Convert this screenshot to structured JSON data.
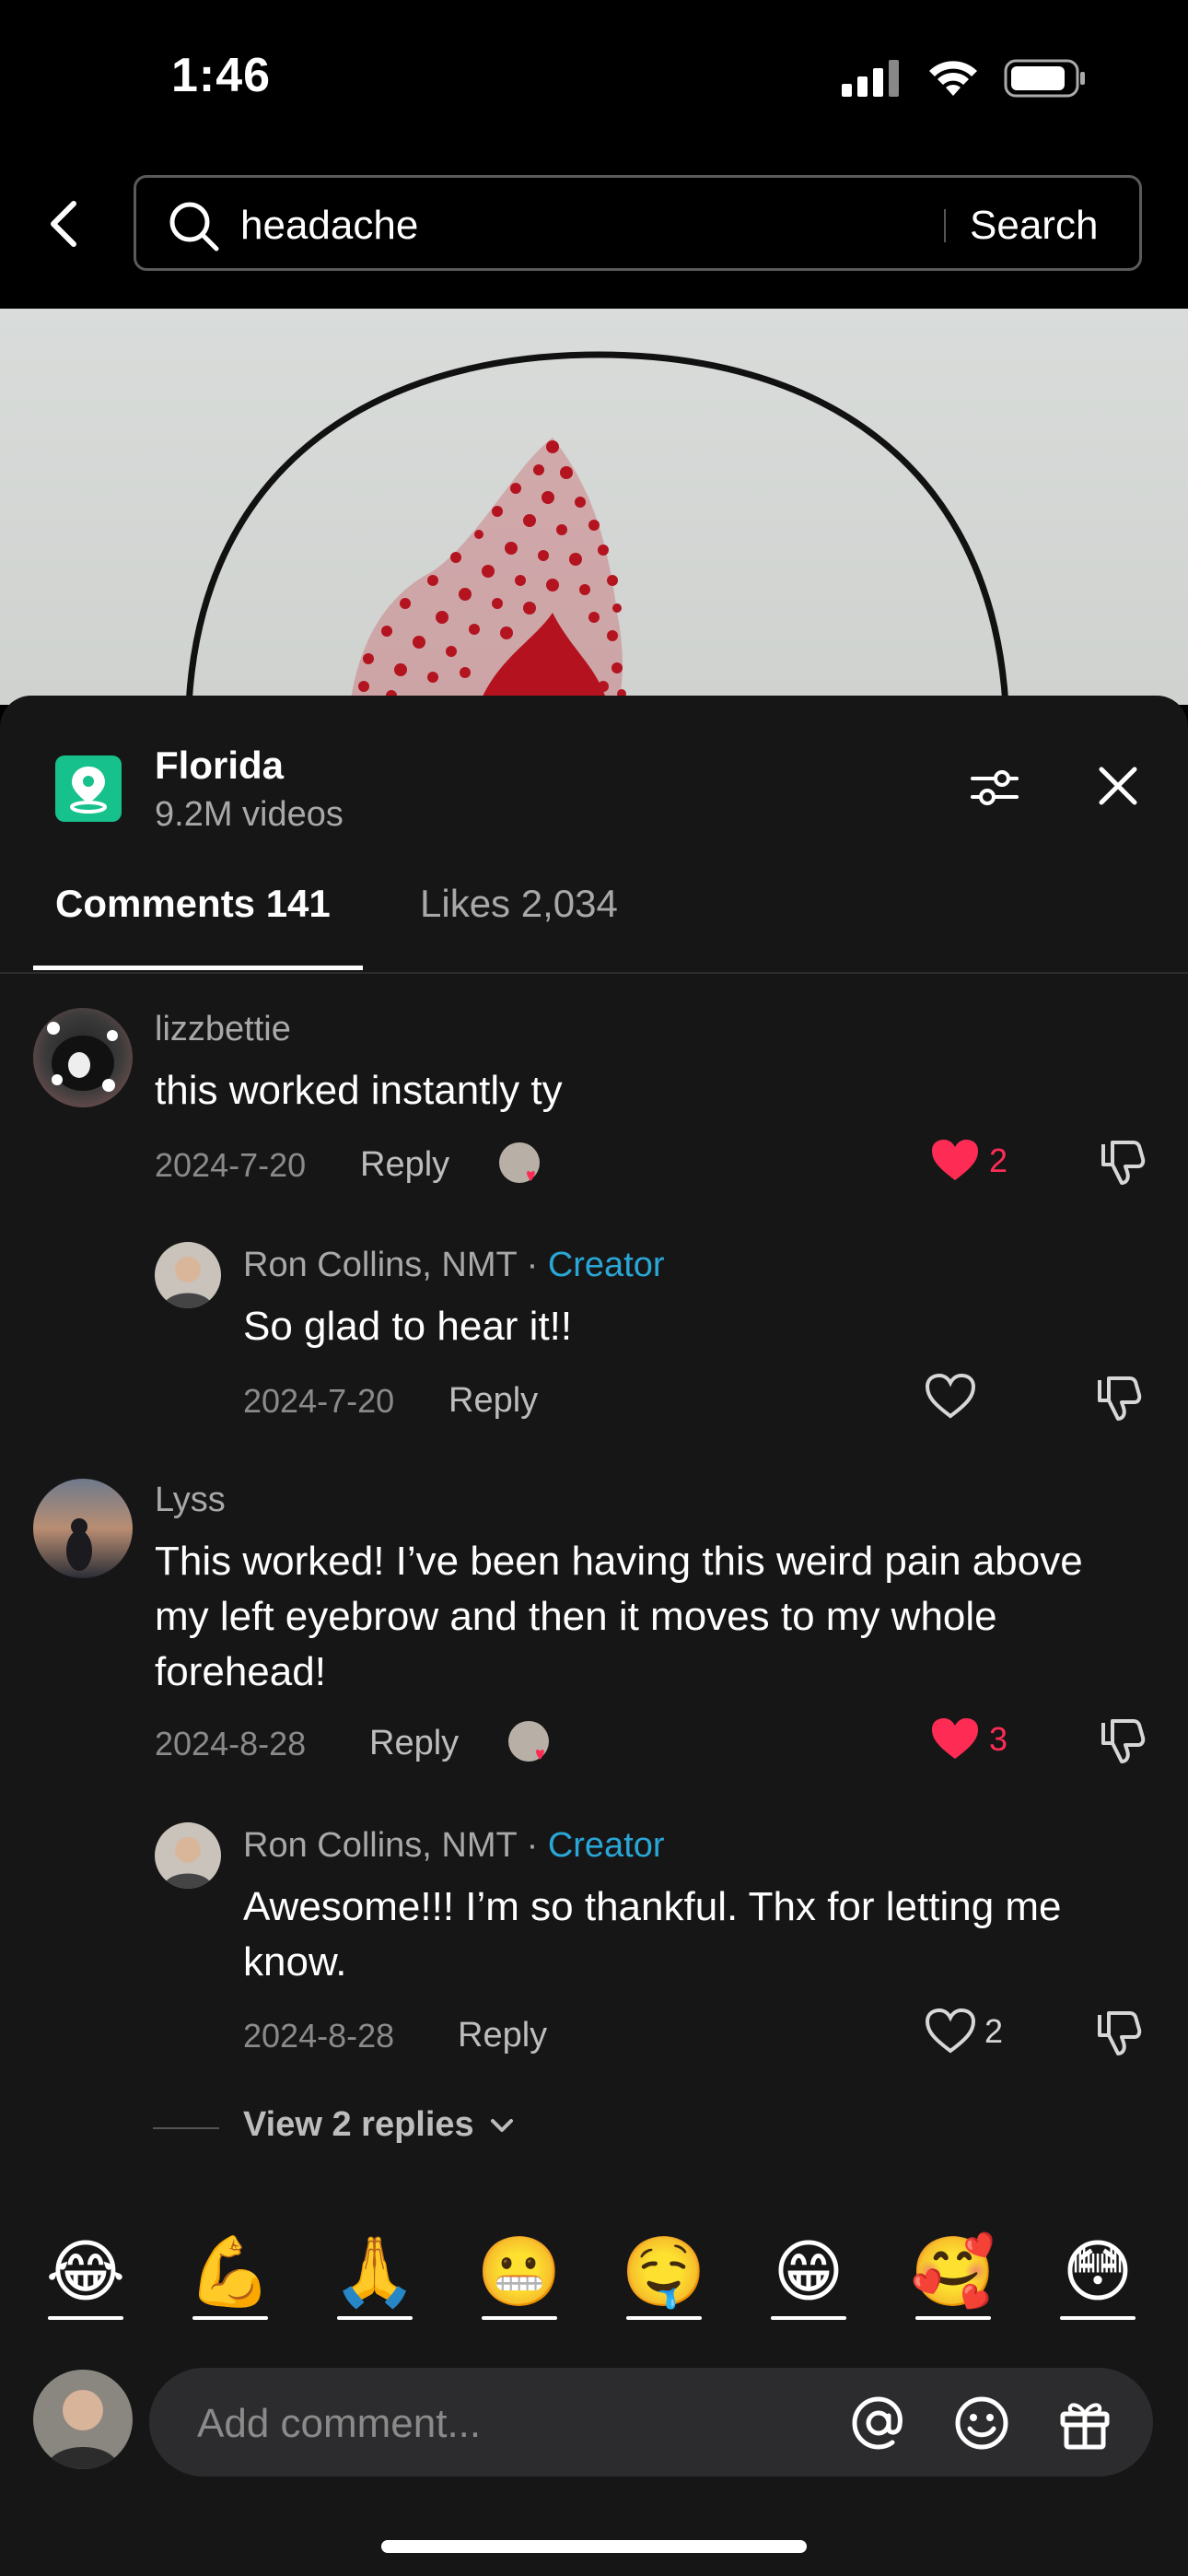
{
  "status_bar": {
    "time": "1:46"
  },
  "search": {
    "query": "headache",
    "button_label": "Search"
  },
  "location": {
    "name": "Florida",
    "video_count": "9.2M videos"
  },
  "tabs": [
    {
      "label": "Comments 141"
    },
    {
      "label": "Likes 2,034"
    }
  ],
  "comments": [
    {
      "user": "lizzbettie",
      "text": "this worked instantly ty",
      "date": "2024-7-20",
      "reply_label": "Reply",
      "likes": "2",
      "liked": true
    },
    {
      "user": "Ron Collins, NMT",
      "badge": "Creator",
      "text": "So glad to hear it!!",
      "date": "2024-7-20",
      "reply_label": "Reply",
      "likes": "",
      "liked": false
    },
    {
      "user": "Lyss",
      "text": "This worked! I’ve been having this weird pain above my left eyebrow and then it moves to my whole forehead!",
      "date": "2024-8-28",
      "reply_label": "Reply",
      "likes": "3",
      "liked": true
    },
    {
      "user": "Ron Collins, NMT",
      "badge": "Creator",
      "text": "Awesome!!! I’m so thankful. Thx for letting me know.",
      "date": "2024-8-28",
      "reply_label": "Reply",
      "likes": "2",
      "liked": false
    }
  ],
  "view_replies": "View 2 replies",
  "emoji_bar": [
    "😂",
    "💪",
    "🙏",
    "😬",
    "🤤",
    "😁",
    "🥰",
    "😳"
  ],
  "composer": {
    "placeholder": "Add comment..."
  },
  "colors": {
    "like_red": "#fe2c55",
    "creator_blue": "#2aa7d6",
    "location_green": "#17c18c",
    "sheet_bg": "#161617"
  }
}
